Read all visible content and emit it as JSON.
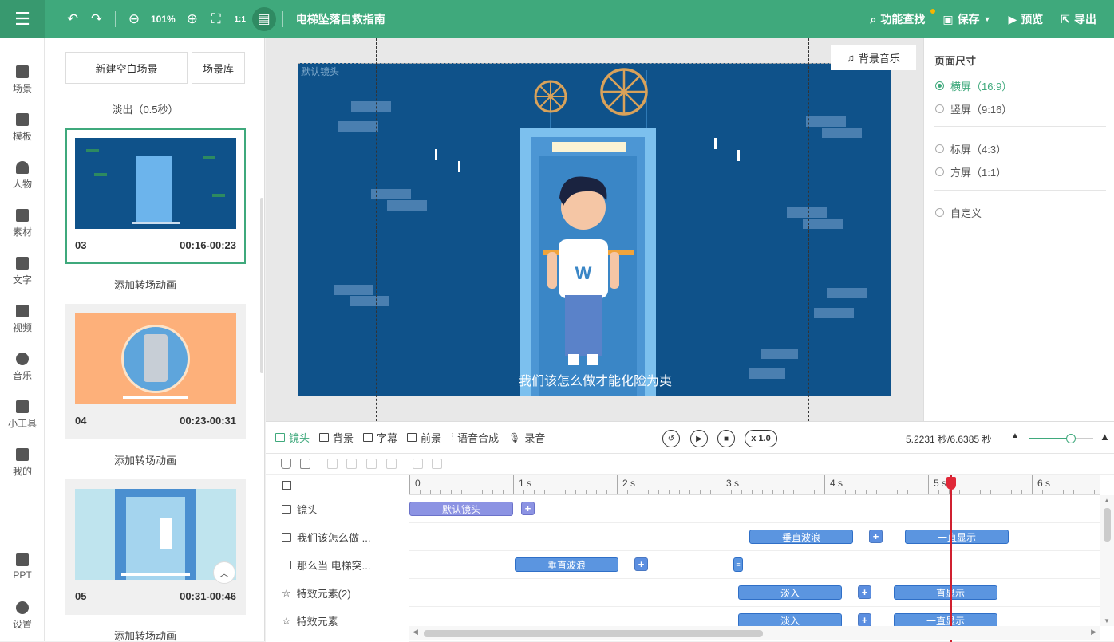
{
  "topbar": {
    "zoom": "101%",
    "title": "电梯坠落自救指南",
    "feature_search": "功能查找",
    "save": "保存",
    "preview": "预览",
    "export": "导出"
  },
  "leftnav": [
    "场景",
    "模板",
    "人物",
    "素材",
    "文字",
    "视频",
    "音乐",
    "小工具",
    "我的",
    "PPT",
    "设置"
  ],
  "scenes": {
    "new_blank": "新建空白场景",
    "library": "场景库",
    "fade_out": "淡出（0.5秒）",
    "add_transition": "添加转场动画",
    "cards": [
      {
        "num": "03",
        "time": "00:16-00:23"
      },
      {
        "num": "04",
        "time": "00:23-00:31"
      },
      {
        "num": "05",
        "time": "00:31-00:46"
      }
    ]
  },
  "canvas": {
    "camera_label": "默认镜头",
    "bgm_button": "背景音乐",
    "caption": "我们该怎么做才能化险为夷",
    "shirt_letter": "W"
  },
  "props": {
    "title": "页面尺寸",
    "options": [
      "横屏（16:9）",
      "竖屏（9:16）",
      "标屏（4:3）",
      "方屏（1:1）",
      "自定义"
    ],
    "selected": 0
  },
  "timeline": {
    "tabs": [
      "镜头",
      "背景",
      "字幕",
      "前景",
      "语音合成",
      "录音"
    ],
    "speed": "x 1.0",
    "time_readout": "5.2231 秒/6.6385 秒",
    "ruler": [
      "0",
      "1 s",
      "2 s",
      "3 s",
      "4 s",
      "5 s",
      "6 s"
    ],
    "rows": [
      {
        "label": "镜头"
      },
      {
        "label": "我们该怎么做 ..."
      },
      {
        "label": "那么当 电梯突..."
      },
      {
        "label": "特效元素(2)"
      },
      {
        "label": "特效元素"
      }
    ],
    "clips": {
      "default_camera": "默认镜头",
      "vertical_wave": "垂直波浪",
      "always_show": "一直显示",
      "fade_in": "淡入"
    },
    "playhead_seconds": 5.2231,
    "total_seconds": 6.6385
  },
  "colors": {
    "brand": "#3fa97c",
    "stage": "#0f528a",
    "clip": "#5b95e0",
    "playhead": "#d02030"
  }
}
